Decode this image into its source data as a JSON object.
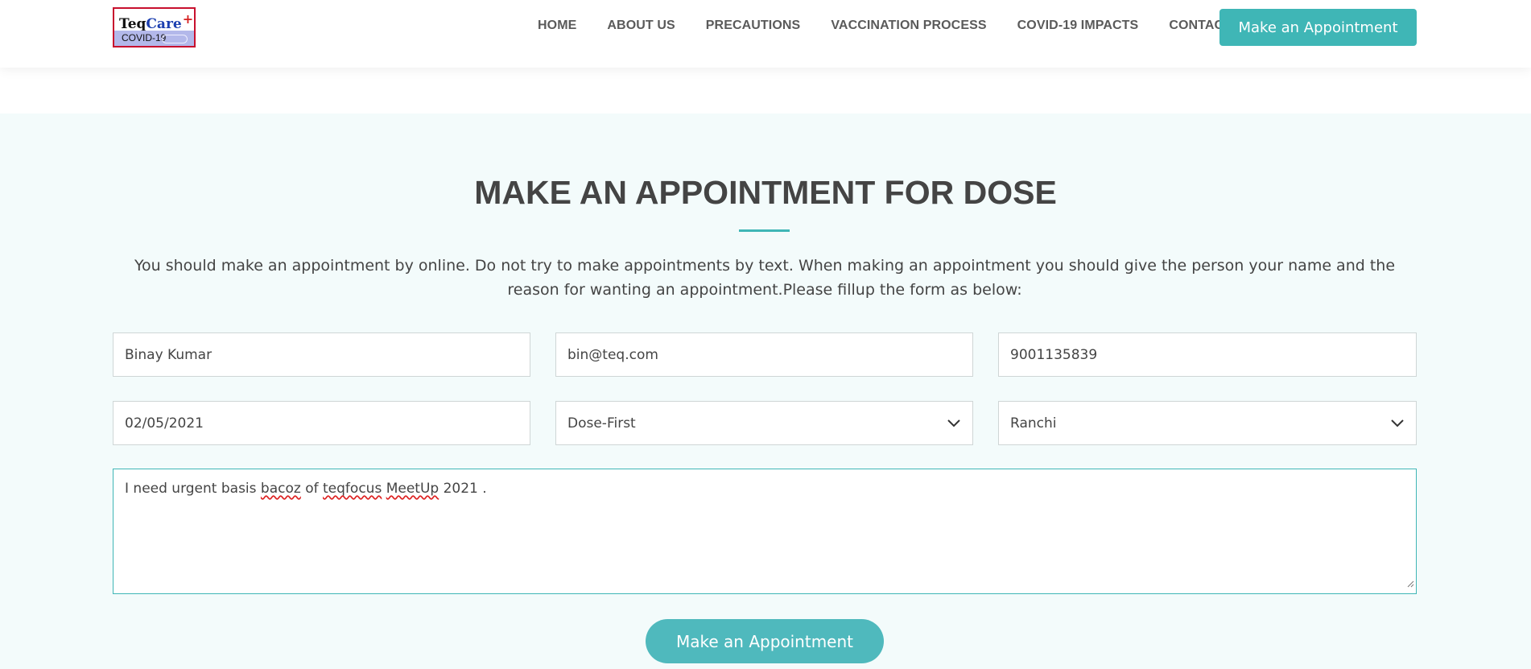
{
  "logo": {
    "brand_part1": "Teq",
    "brand_part2": "Care",
    "brand_plus": "+",
    "subtitle": "COVID-19"
  },
  "nav": {
    "items": [
      {
        "label": "HOME"
      },
      {
        "label": "ABOUT US"
      },
      {
        "label": "PRECAUTIONS"
      },
      {
        "label": "VACCINATION PROCESS"
      },
      {
        "label": "COVID-19 IMPACTS"
      },
      {
        "label": "CONTACT"
      }
    ],
    "cta_label": "Make an Appointment"
  },
  "appointment": {
    "title": "MAKE AN APPOINTMENT FOR DOSE",
    "intro": "You should make an appointment by online. Do not try to make appointments by text. When making an appointment you should give the person your name and the reason for wanting an appointment.Please fillup the form as below:",
    "form": {
      "name": "Binay Kumar",
      "email": "bin@teq.com",
      "phone": "9001135839",
      "date": "02/05/2021",
      "dose_selected": "Dose-First",
      "city_selected": "Ranchi",
      "message_parts": [
        "I need urgent basis ",
        "bacoz",
        " of ",
        "teqfocus",
        " ",
        "MeetUp",
        " 2021 ."
      ]
    },
    "submit_label": "Make an Appointment"
  },
  "colors": {
    "accent": "#3fb6b6",
    "section_bg": "#f3fbfb",
    "text": "#444444",
    "spellcheck": "#dd2222"
  }
}
